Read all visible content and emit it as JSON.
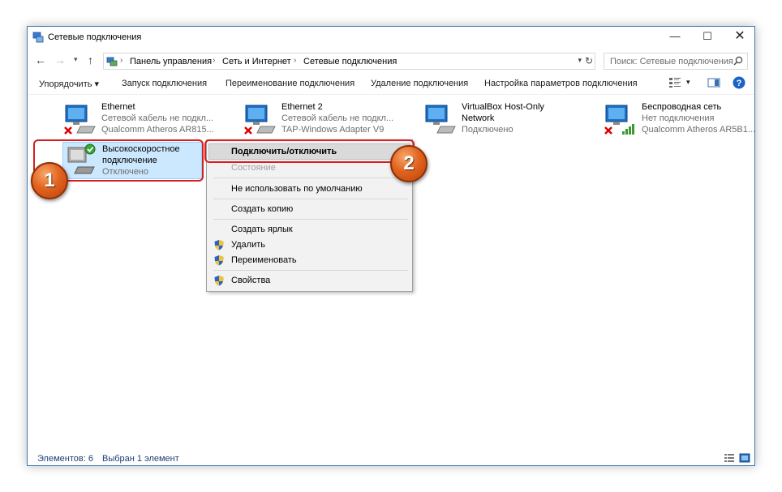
{
  "window": {
    "title": "Сетевые подключения"
  },
  "address": {
    "breadcrumbs": [
      "Панель управления",
      "Сеть и Интернет",
      "Сетевые подключения"
    ],
    "search_placeholder": "Поиск: Сетевые подключения"
  },
  "toolbar": {
    "organize": "Упорядочить",
    "start": "Запуск подключения",
    "rename": "Переименование подключения",
    "delete": "Удаление подключения",
    "settings": "Настройка параметров подключения"
  },
  "connections": [
    {
      "name": "Ethernet",
      "line1": "Сетевой кабель не подкл...",
      "line2": "Qualcomm Atheros AR815...",
      "status_icon": "disconnected-x-icon"
    },
    {
      "name": "Ethernet 2",
      "line1": "Сетевой кабель не подкл...",
      "line2": "TAP-Windows Adapter V9",
      "status_icon": "disconnected-x-icon"
    },
    {
      "name": "VirtualBox Host-Only",
      "line1": "Network",
      "line2": "Подключено",
      "status_icon": "none"
    },
    {
      "name": "Беспроводная сеть",
      "line1": "Нет подключения",
      "line2": "Qualcomm Atheros AR5B1...",
      "status_icon": "disconnected-x-icon"
    },
    {
      "name": "Высокоскоростное",
      "line1": "подключение",
      "line2": "Отключено",
      "status_icon": "check-icon",
      "selected": true
    }
  ],
  "context_menu": {
    "items": [
      {
        "label": "Подключить/отключить",
        "bold": true
      },
      {
        "label": "Состояние",
        "disabled": true
      },
      {
        "label": "Не использовать по умолчанию"
      },
      {
        "label": "Создать копию"
      },
      {
        "label": "Создать ярлык"
      },
      {
        "label": "Удалить",
        "shield": true
      },
      {
        "label": "Переименовать",
        "shield": true
      },
      {
        "label": "Свойства",
        "shield": true
      }
    ]
  },
  "status": {
    "count": "Элементов: 6",
    "selected": "Выбран 1 элемент"
  },
  "callouts": [
    "1",
    "2"
  ],
  "colors": {
    "accent": "#3e79b4",
    "selection": "#cce8ff",
    "callout_ring": "#d81e1e",
    "badge": "#e2641f",
    "help": "#1a63c8"
  }
}
